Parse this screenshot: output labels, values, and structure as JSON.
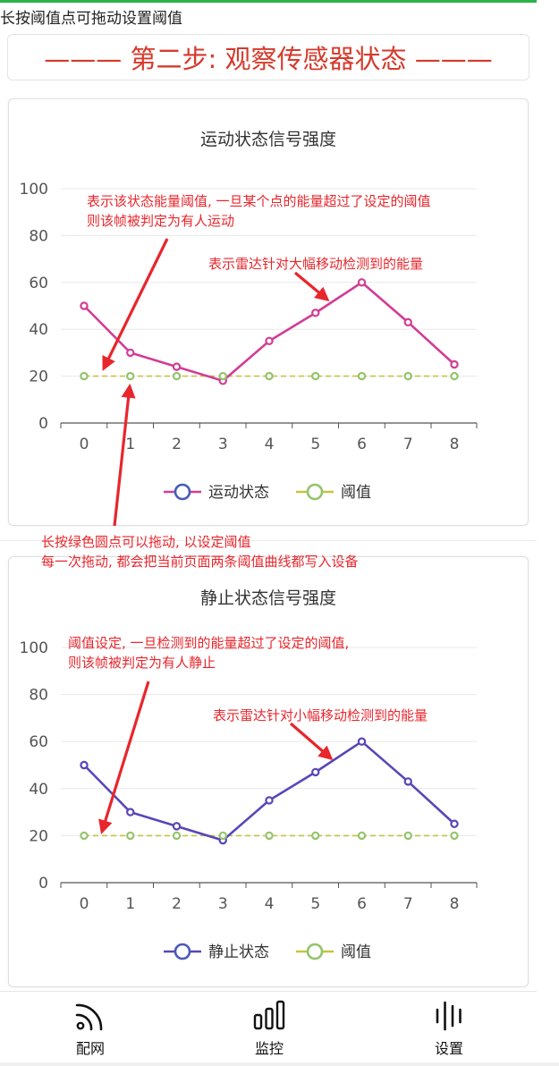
{
  "hint_text": "长按阈值点可拖动设置阈值",
  "step_title": "——— 第二步: 观察传感器状态 ———",
  "colors": {
    "accent_green": "#2db24a",
    "title_red": "#d63a2c",
    "annotation_red": "#e8262c",
    "motion_series": "#d23c95",
    "static_series": "#5a45b8",
    "threshold_series": "#93c46b",
    "threshold_dash": "#c9c23f",
    "legend_marker": "#4a5ab5"
  },
  "chart_data": [
    {
      "type": "line",
      "title": "运动状态信号强度",
      "x": [
        0,
        1,
        2,
        3,
        4,
        5,
        6,
        7,
        8
      ],
      "xticks": [
        "0",
        "1",
        "2",
        "3",
        "4",
        "5",
        "6",
        "7",
        "8"
      ],
      "yticks": [
        "0",
        "20",
        "40",
        "60",
        "80",
        "100"
      ],
      "ylim": [
        0,
        100
      ],
      "series": [
        {
          "name": "运动状态",
          "values": [
            50,
            30,
            24,
            18,
            35,
            47,
            60,
            43,
            25
          ]
        },
        {
          "name": "阈值",
          "values": [
            20,
            20,
            20,
            20,
            20,
            20,
            20,
            20,
            20
          ]
        }
      ],
      "legend": "bottom",
      "grid": true,
      "annotations": [
        {
          "lines": [
            "表示该状态能量阈值, 一旦某个点的能量超过了设定的阈值",
            "则该帧被判定为有人运动"
          ]
        },
        {
          "lines": [
            "表示雷达针对大幅移动检测到的能量"
          ]
        },
        {
          "lines": [
            "长按绿色圆点可以拖动, 以设定阈值",
            "每一次拖动, 都会把当前页面两条阈值曲线都写入设备"
          ]
        }
      ]
    },
    {
      "type": "line",
      "title": "静止状态信号强度",
      "x": [
        0,
        1,
        2,
        3,
        4,
        5,
        6,
        7,
        8
      ],
      "xticks": [
        "0",
        "1",
        "2",
        "3",
        "4",
        "5",
        "6",
        "7",
        "8"
      ],
      "yticks": [
        "0",
        "20",
        "40",
        "60",
        "80",
        "100"
      ],
      "ylim": [
        0,
        100
      ],
      "series": [
        {
          "name": "静止状态",
          "values": [
            50,
            30,
            24,
            18,
            35,
            47,
            60,
            43,
            25
          ]
        },
        {
          "name": "阈值",
          "values": [
            20,
            20,
            20,
            20,
            20,
            20,
            20,
            20,
            20
          ]
        }
      ],
      "legend": "bottom",
      "grid": true,
      "annotations": [
        {
          "lines": [
            "阈值设定, 一旦检测到的能量超过了设定的阈值,",
            "则该帧被判定为有人静止"
          ]
        },
        {
          "lines": [
            "表示雷达针对小幅移动检测到的能量"
          ]
        }
      ]
    }
  ],
  "nav": [
    {
      "label": "配网",
      "icon": "wifi-signal-icon"
    },
    {
      "label": "监控",
      "icon": "bar-chart-icon"
    },
    {
      "label": "设置",
      "icon": "vertical-bars-icon"
    }
  ]
}
